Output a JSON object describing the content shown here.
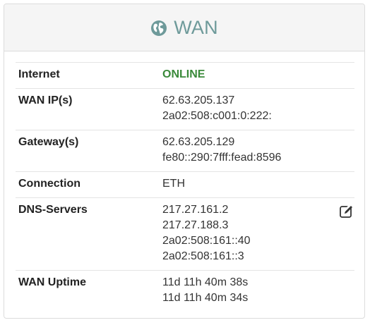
{
  "header": {
    "icon": "globe-icon",
    "title": "WAN"
  },
  "colors": {
    "title": "#6e9a9a",
    "status_online": "#3a8a3a"
  },
  "rows": {
    "internet": {
      "label": "Internet",
      "value": "ONLINE"
    },
    "wan_ip": {
      "label": "WAN IP(s)",
      "values": [
        "62.63.205.137",
        "2a02:508:c001:0:222:"
      ]
    },
    "gateway": {
      "label": "Gateway(s)",
      "values": [
        "62.63.205.129",
        "fe80::290:7fff:fead:8596"
      ]
    },
    "connection": {
      "label": "Connection",
      "value": "ETH"
    },
    "dns": {
      "label": "DNS-Servers",
      "values": [
        "217.27.161.2",
        "217.27.188.3",
        "2a02:508:161::40",
        "2a02:508:161::3"
      ],
      "action_icon": "edit-icon"
    },
    "uptime": {
      "label": "WAN Uptime",
      "values": [
        "11d 11h 40m 38s",
        "11d 11h 40m 34s"
      ]
    }
  }
}
